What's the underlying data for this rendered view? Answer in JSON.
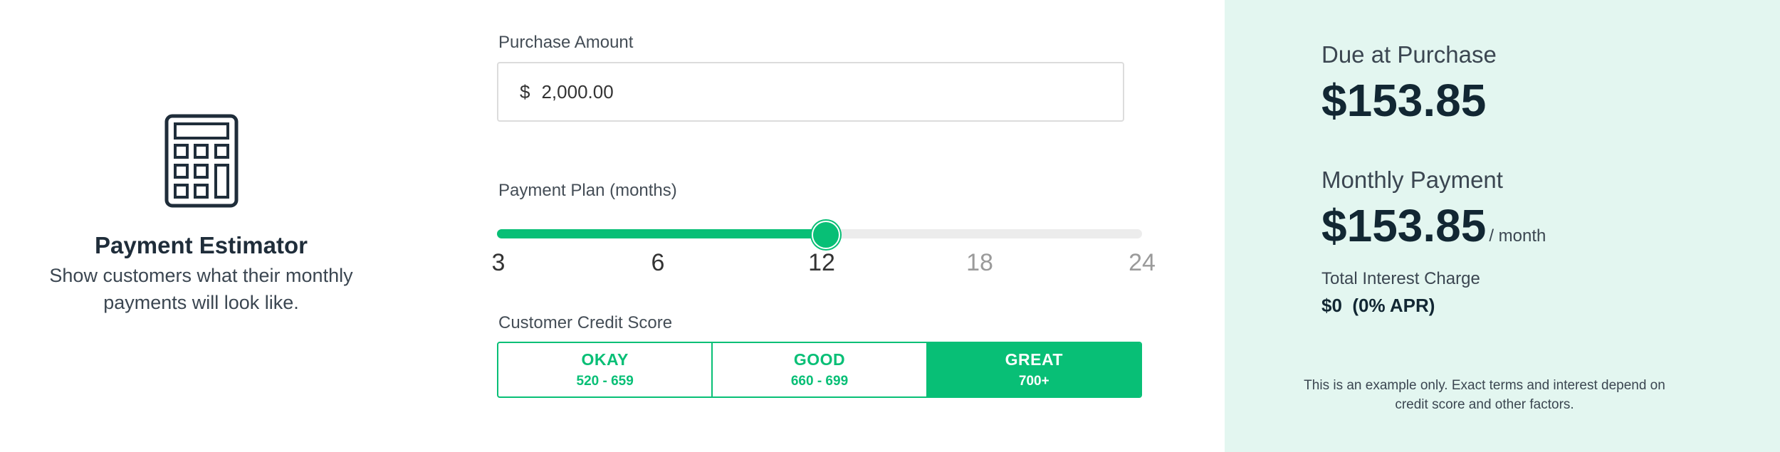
{
  "intro": {
    "icon": "calculator-icon",
    "title": "Payment Estimator",
    "description": "Show customers what their monthly payments will look like."
  },
  "form": {
    "amount_label": "Purchase Amount",
    "currency_symbol": "$",
    "amount_value": "2,000.00",
    "plan_label": "Payment Plan (months)",
    "plan_ticks": [
      "3",
      "6",
      "12",
      "18",
      "24"
    ],
    "plan_selected": 12,
    "plan_min": 3,
    "plan_max": 24,
    "credit_label": "Customer Credit Score",
    "credit_options": [
      {
        "name": "OKAY",
        "range": "520 - 659",
        "selected": false
      },
      {
        "name": "GOOD",
        "range": "660 - 699",
        "selected": false
      },
      {
        "name": "GREAT",
        "range": "700+",
        "selected": true
      }
    ]
  },
  "summary": {
    "due_label": "Due at Purchase",
    "due_value": "$153.85",
    "monthly_label": "Monthly Payment",
    "monthly_value": "$153.85",
    "monthly_unit": "/ month",
    "interest_label": "Total Interest Charge",
    "interest_value": "$0  (0% APR)",
    "disclaimer": "This is an example only. Exact terms and interest depend on credit score and other factors."
  },
  "colors": {
    "accent": "#08bf76",
    "summary_bg": "#e3f6f0",
    "text_dark": "#122733"
  }
}
